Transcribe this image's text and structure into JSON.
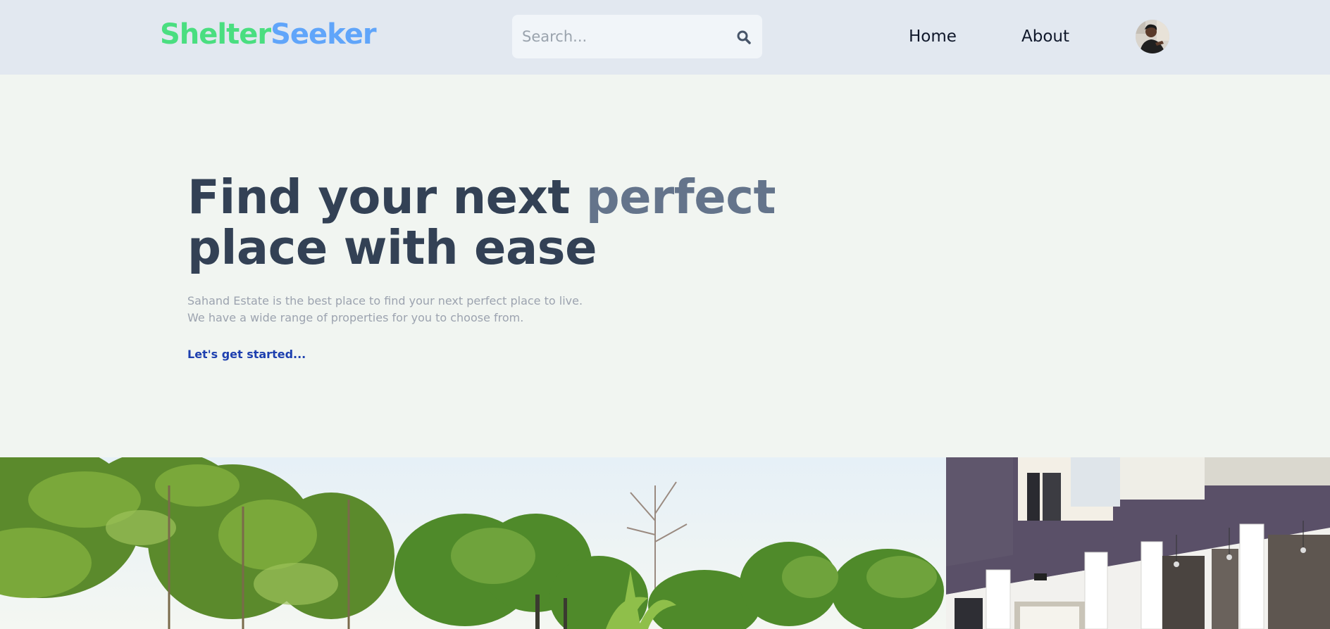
{
  "header": {
    "logo_part1": "Shelter",
    "logo_part2": "Seeker",
    "search": {
      "placeholder": "Search...",
      "value": "",
      "icon": "search-icon"
    },
    "nav": {
      "home_label": "Home",
      "about_label": "About"
    }
  },
  "hero": {
    "title_line1_start": "Find your next ",
    "title_accent": "perfect",
    "title_line2": "place with ease",
    "description_line1": "Sahand Estate is the best place to find your next perfect place to live.",
    "description_line2": "We have a wide range of properties for you to choose from.",
    "cta_label": "Let's get started..."
  },
  "colors": {
    "header_bg": "#e2e8f0",
    "page_bg": "#f1f5f1",
    "logo_green": "#4ade80",
    "logo_blue": "#60a5fa",
    "title_dark": "#334155",
    "title_accent": "#64748b",
    "cta_blue": "#1e40af"
  }
}
